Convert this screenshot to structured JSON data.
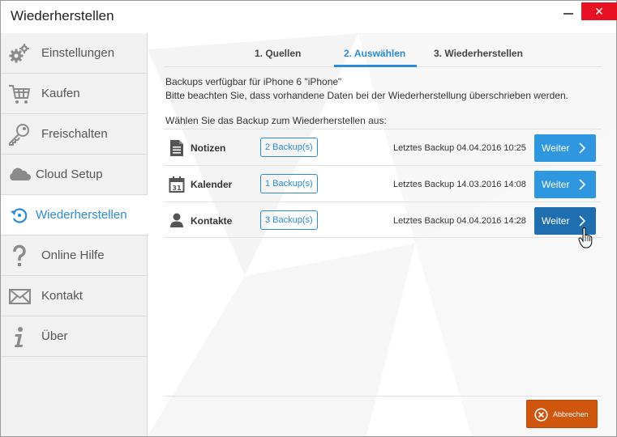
{
  "window": {
    "title": "Wiederherstellen",
    "close_glyph": "✕"
  },
  "sidebar": {
    "items": [
      {
        "label": "Einstellungen",
        "icon": "gears-icon"
      },
      {
        "label": "Kaufen",
        "icon": "cart-icon"
      },
      {
        "label": "Freischalten",
        "icon": "key-icon"
      },
      {
        "label": "Cloud Setup",
        "icon": "cloud-icon"
      },
      {
        "label": "Wiederherstellen",
        "icon": "restore-icon",
        "active": true
      },
      {
        "label": "Online Hilfe",
        "icon": "question-icon"
      },
      {
        "label": "Kontakt",
        "icon": "envelope-icon"
      },
      {
        "label": "Über",
        "icon": "info-icon"
      }
    ]
  },
  "steps": {
    "items": [
      "1. Quellen",
      "2. Auswählen",
      "3. Wiederherstellen"
    ],
    "active_index": 1
  },
  "info": {
    "line1": "Backups verfügbar für iPhone 6 \"iPhone\"",
    "line2": "Bitte beachten Sie, dass vorhandene Daten bei der Wiederherstellung überschrieben werden.",
    "prompt": "Wählen Sie das Backup zum Wiederherstellen aus:"
  },
  "backups": [
    {
      "name": "Notizen",
      "icon": "notes-icon",
      "count": "2 Backup(s)",
      "last": "Letztes Backup 04.04.2016 10:25",
      "button": "Weiter"
    },
    {
      "name": "Kalender",
      "icon": "calendar-icon",
      "count": "1 Backup(s)",
      "last": "Letztes Backup 14.03.2016 14:08",
      "button": "Weiter"
    },
    {
      "name": "Kontakte",
      "icon": "person-icon",
      "count": "3 Backup(s)",
      "last": "Letztes Backup 04.04.2016 14:28",
      "button": "Weiter",
      "hover": true
    }
  ],
  "footer": {
    "cancel_label": "Abbrechen"
  },
  "colors": {
    "accent": "#2a8bd8",
    "button": "#2f96e0",
    "button_hover": "#1f6fb0",
    "cancel": "#d0560d",
    "close": "#e81123"
  }
}
